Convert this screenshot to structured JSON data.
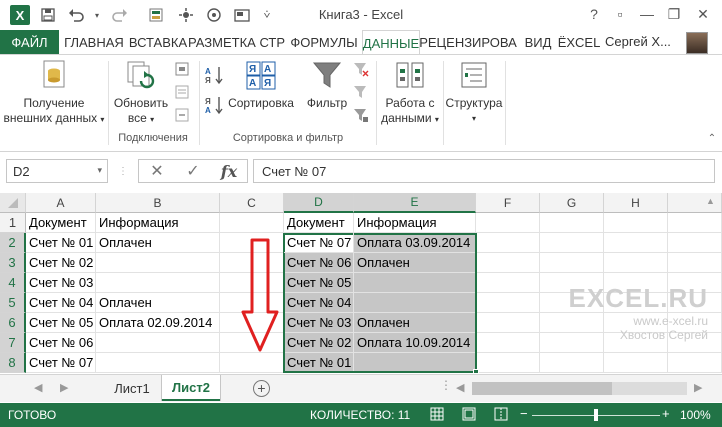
{
  "window": {
    "title": "Книга3 - Excel",
    "app_logo": "X",
    "controls": [
      "?",
      "▫",
      "—",
      "❐",
      "✕"
    ]
  },
  "quick_access": [
    "save-icon",
    "undo-icon",
    "redo-icon",
    "format-icon",
    "macro-icon",
    "camera-icon",
    "screenshot-icon",
    "more-icon"
  ],
  "ribbon_tabs": {
    "file": "ФАЙЛ",
    "tabs": [
      "ГЛАВНАЯ",
      "ВСТАВКА",
      "РАЗМЕТКА СТР",
      "ФОРМУЛЫ",
      "ДАННЫЕ",
      "РЕЦЕНЗИРОВА",
      "ВИД",
      "ЁXCEL"
    ],
    "active": "ДАННЫЕ",
    "user": "Сергей Х..."
  },
  "ribbon": {
    "get_data_line1": "Получение",
    "get_data_line2": "внешних данных",
    "refresh_line1": "Обновить",
    "refresh_line2": "все",
    "group_connections": "Подключения",
    "sort": "Сортировка",
    "filter": "Фильтр",
    "group_sort_filter": "Сортировка и фильтр",
    "data_tools_line1": "Работа с",
    "data_tools_line2": "данными",
    "outline": "Структура"
  },
  "formula_bar": {
    "name_box": "D2",
    "cancel": "✕",
    "enter": "✓",
    "fx": "fx",
    "formula": "Счет № 07"
  },
  "columns": [
    "A",
    "B",
    "C",
    "D",
    "E",
    "F",
    "G",
    "H"
  ],
  "rows": [
    "1",
    "2",
    "3",
    "4",
    "5",
    "6",
    "7",
    "8"
  ],
  "cells": {
    "A": [
      "Документ",
      "Счет № 01",
      "Счет № 02",
      "Счет № 03",
      "Счет № 04",
      "Счет № 05",
      "Счет № 06",
      "Счет № 07"
    ],
    "B": [
      "Информация",
      "Оплачен",
      "",
      "",
      "Оплачен",
      "Оплата 02.09.2014",
      "",
      ""
    ],
    "D": [
      "Документ",
      "Счет № 07",
      "Счет № 06",
      "Счет № 05",
      "Счет № 04",
      "Счет № 03",
      "Счет № 02",
      "Счет № 01"
    ],
    "E": [
      "Информация",
      "Оплата 03.09.2014",
      "Оплачен",
      "",
      "",
      "Оплачен",
      "Оплата 10.09.2014",
      ""
    ]
  },
  "watermark": {
    "logo": "EXCEL.RU",
    "url": "www.e-xcel.ru",
    "author": "Хвостов Сергей"
  },
  "sheets": {
    "tabs": [
      "Лист1",
      "Лист2"
    ],
    "active": "Лист2",
    "add": "+"
  },
  "status": {
    "ready": "ГОТОВО",
    "count": "КОЛИЧЕСТВО: 11",
    "zoom": "100%",
    "zoom_minus": "−",
    "zoom_plus": "+"
  },
  "colors": {
    "accent": "#217346",
    "arrow": "#e02020",
    "selection": "#c6c6c6"
  }
}
